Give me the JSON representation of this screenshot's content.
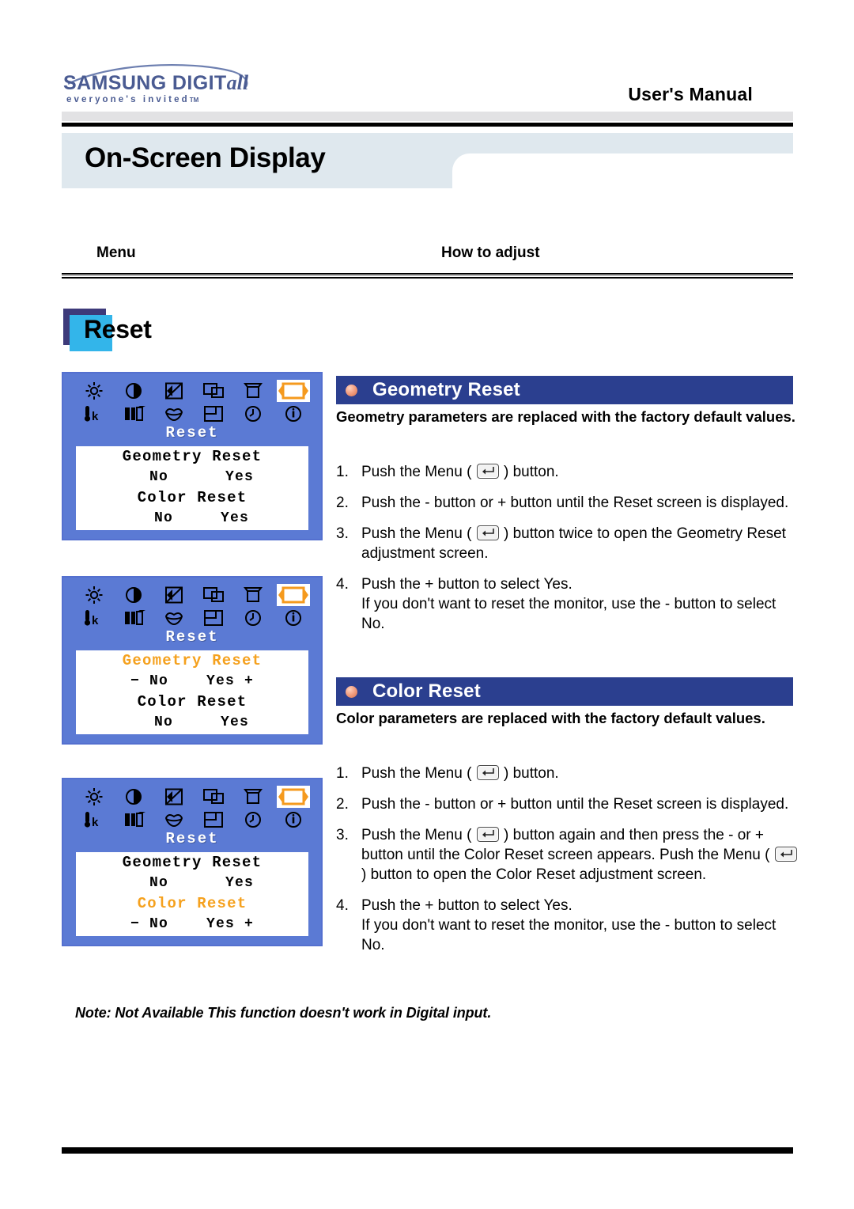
{
  "header": {
    "logo_main_prefix": "SAMSUNG DIGIT",
    "logo_main_italic": "all",
    "logo_tagline": "everyone's invited",
    "logo_tagline_tm": "TM",
    "manual_label": "User's Manual"
  },
  "page_title": "On-Screen Display",
  "columns": {
    "menu": "Menu",
    "how_to_adjust": "How to adjust"
  },
  "section_heading": "Reset",
  "colors": {
    "title_band": "#dfe8ee",
    "osd_blue": "#5b7ad4",
    "osd_highlight": "#f5a11e",
    "section_bar": "#2b3f8f",
    "bullet": "#e8906b",
    "reset_square_back": "#3d3a7a",
    "reset_square_front": "#33b5ea"
  },
  "osd_icons": {
    "row1": [
      "brightness-icon",
      "contrast-icon",
      "image-sharpness-icon",
      "h-position-icon",
      "trapezoid-icon",
      "reset-icon"
    ],
    "row2": [
      "color-temperature-icon",
      "rgb-color-control-icon",
      "color-tone-icon",
      "v-position-icon",
      "osd-time-icon",
      "information-icon"
    ],
    "selected": "reset-icon"
  },
  "osd_panels": [
    {
      "title": "Reset",
      "rows": [
        {
          "label": "Geometry Reset",
          "highlight": false,
          "options": "  No      Yes"
        },
        {
          "label": "Color Reset",
          "highlight": false,
          "options": "  No     Yes"
        }
      ]
    },
    {
      "title": "Reset",
      "rows": [
        {
          "label": "Geometry Reset",
          "highlight": true,
          "options": "− No    Yes +"
        },
        {
          "label": "Color Reset",
          "highlight": false,
          "options": "  No     Yes"
        }
      ]
    },
    {
      "title": "Reset",
      "rows": [
        {
          "label": "Geometry Reset",
          "highlight": false,
          "options": "  No      Yes"
        },
        {
          "label": "Color Reset",
          "highlight": true,
          "options": "− No    Yes +"
        }
      ]
    }
  ],
  "sections": [
    {
      "id": "geometry",
      "bar_title": "Geometry Reset",
      "description": "Geometry parameters are replaced with the factory default values.",
      "steps": [
        {
          "num": "1.",
          "parts": [
            {
              "t": "text",
              "v": "Push the Menu ( "
            },
            {
              "t": "menu-icon"
            },
            {
              "t": "text",
              "v": " ) button."
            }
          ]
        },
        {
          "num": "2.",
          "parts": [
            {
              "t": "text",
              "v": "Push the - button or + button until the Reset screen is displayed."
            }
          ]
        },
        {
          "num": "3.",
          "parts": [
            {
              "t": "text",
              "v": "Push the Menu ( "
            },
            {
              "t": "menu-icon"
            },
            {
              "t": "text",
              "v": " ) button twice to open the Geometry Reset adjustment screen."
            }
          ]
        },
        {
          "num": "4.",
          "parts": [
            {
              "t": "text",
              "v": "Push the + button to select Yes."
            },
            {
              "t": "break"
            },
            {
              "t": "text",
              "v": "If you don't want to reset the monitor, use the - button to select No."
            }
          ]
        }
      ]
    },
    {
      "id": "color",
      "bar_title": "Color Reset",
      "description": "Color parameters are replaced with the factory default values.",
      "steps": [
        {
          "num": "1.",
          "parts": [
            {
              "t": "text",
              "v": "Push the Menu ( "
            },
            {
              "t": "menu-icon"
            },
            {
              "t": "text",
              "v": " ) button."
            }
          ]
        },
        {
          "num": "2.",
          "parts": [
            {
              "t": "text",
              "v": "Push the - button or + button until the Reset screen is displayed."
            }
          ]
        },
        {
          "num": "3.",
          "parts": [
            {
              "t": "text",
              "v": "Push the Menu ( "
            },
            {
              "t": "menu-icon"
            },
            {
              "t": "text",
              "v": " ) button again and then press the - or + button until the Color Reset screen appears. Push the Menu ( "
            },
            {
              "t": "menu-icon"
            },
            {
              "t": "text",
              "v": " ) button to open the Color Reset adjustment screen."
            }
          ]
        },
        {
          "num": "4.",
          "parts": [
            {
              "t": "text",
              "v": "Push the + button to select Yes."
            },
            {
              "t": "break"
            },
            {
              "t": "text",
              "v": "If you don't want to reset the monitor, use the - button to select No."
            }
          ]
        }
      ]
    }
  ],
  "note": "Note: Not Available  This function doesn't work in Digital input."
}
